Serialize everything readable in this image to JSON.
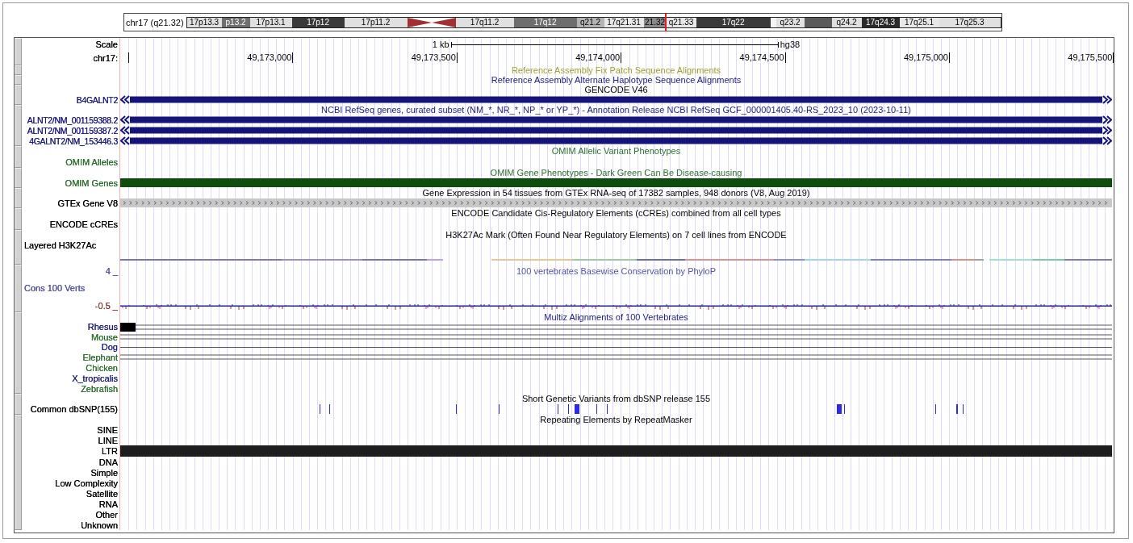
{
  "ideogram": {
    "label": "chr17 (q21.32)",
    "bands": [
      {
        "kind": "band",
        "label": "17p13.3",
        "color": "#e0e0e0",
        "selected": false
      },
      {
        "kind": "band",
        "label": "p13.2",
        "color": "#6e6e6e",
        "selected": false
      },
      {
        "kind": "band",
        "label": "17p13.1",
        "color": "#e0e0e0",
        "selected": false
      },
      {
        "kind": "band",
        "label": "17p12",
        "color": "#3a3a3a",
        "selected": false
      },
      {
        "kind": "band",
        "label": "17p11.2",
        "color": "#e0e0e0",
        "selected": false
      },
      {
        "kind": "centromere",
        "color": "#a33030",
        "selected": false
      },
      {
        "kind": "band",
        "label": "17q11.2",
        "color": "#e0e0e0",
        "selected": false
      },
      {
        "kind": "band",
        "label": "17q12",
        "color": "#6e6e6e",
        "selected": false
      },
      {
        "kind": "band",
        "label": "q21.2",
        "color": "#b4b4b4",
        "selected": false
      },
      {
        "kind": "band",
        "label": "17q21.31",
        "color": "#e8e8e8",
        "selected": false
      },
      {
        "kind": "band",
        "label": "21.32",
        "color": "#8a8a8a",
        "selected": true
      },
      {
        "kind": "band",
        "label": "q21.33",
        "color": "#e8e8e8",
        "selected": false
      },
      {
        "kind": "band",
        "label": "17q22",
        "color": "#3a3a3a",
        "selected": false
      },
      {
        "kind": "band",
        "color": "#f4f4f4",
        "selected": false
      },
      {
        "kind": "band",
        "label": "q23.2",
        "color": "#e0e0e0",
        "selected": false
      },
      {
        "kind": "band",
        "color": "#5a5a5a",
        "selected": false
      },
      {
        "kind": "band",
        "label": "q24.2",
        "color": "#e0e0e0",
        "selected": false
      },
      {
        "kind": "band",
        "label": "17q24.3",
        "color": "#2a2a2a",
        "selected": false
      },
      {
        "kind": "band",
        "label": "17q25.1",
        "color": "#e8e8e8",
        "selected": false
      },
      {
        "kind": "band",
        "label": "17q25.3",
        "color": "#e0e0e0",
        "selected": false
      }
    ]
  },
  "tracks": [
    {
      "rows": [
        {
          "kind": "scale",
          "label": {
            "text": "Scale",
            "color": "#000000"
          },
          "scale_label": "1 kb",
          "assembly": "hg38"
        },
        {
          "kind": "ruler",
          "label": {
            "text": "chr17:",
            "color": "#000000"
          },
          "tick_labels": [
            "49,173,000",
            "49,173,500",
            "49,174,000",
            "49,174,500",
            "49,175,000",
            "49,175,500"
          ]
        }
      ]
    },
    {
      "rows": [
        {
          "kind": "title",
          "title": {
            "text": "Reference Assembly Fix Patch Sequence Alignments",
            "color": "#a0a030"
          }
        }
      ]
    },
    {
      "rows": [
        {
          "kind": "title",
          "title": {
            "text": "Reference Assembly Alternate Haplotype Sequence Alignments",
            "color": "#1c1c80"
          }
        }
      ]
    },
    {
      "rows": [
        {
          "kind": "title",
          "title": {
            "text": "GENCODE V46",
            "color": "#000000"
          }
        },
        {
          "kind": "gene",
          "label": {
            "text": "B4GALNT2",
            "color": "#1c1c80"
          },
          "color": "#14147a"
        }
      ]
    },
    {
      "rows": [
        {
          "kind": "title",
          "title": {
            "text": "NCBI RefSeq genes, curated subset (NM_*, NR_*, NP_* or YP_*) - Annotation Release NCBI RefSeq GCF_000001405.40-RS_2023_10 (2023-10-11)",
            "color": "#1c1c80"
          }
        },
        {
          "kind": "gene",
          "label": {
            "text": "ALNT2/NM_001159388.2",
            "color": "#1c1c80"
          },
          "color": "#14147a"
        },
        {
          "kind": "gene",
          "label": {
            "text": "ALNT2/NM_001159387.2",
            "color": "#1c1c80"
          },
          "color": "#14147a"
        },
        {
          "kind": "gene",
          "label": {
            "text": "4GALNT2/NM_153446.3",
            "color": "#1c1c80"
          },
          "color": "#14147a"
        }
      ]
    },
    {
      "rows": [
        {
          "kind": "title",
          "title": {
            "text": "OMIM Allelic Variant Phenotypes",
            "color": "#2e6e2e"
          }
        },
        {
          "kind": "text",
          "label": {
            "text": "OMIM Alleles",
            "color": "#2e6e2e"
          }
        }
      ]
    },
    {
      "rows": [
        {
          "kind": "title",
          "title": {
            "text": "OMIM Gene Phenotypes - Dark Green Can Be Disease-causing",
            "color": "#2e6e2e"
          }
        },
        {
          "kind": "bar",
          "label": {
            "text": "OMIM Genes",
            "color": "#2e6e2e"
          },
          "color": "#0d4d0d"
        }
      ]
    },
    {
      "rows": [
        {
          "kind": "title",
          "title": {
            "text": "Gene Expression in 54 tissues from GTEx RNA-seq of 17382 samples, 948 donors (V8, Aug 2019)",
            "color": "#000000"
          }
        },
        {
          "kind": "chevrons",
          "label": {
            "text": "GTEx Gene V8",
            "color": "#000000"
          },
          "color": "#c8c8c8"
        }
      ]
    },
    {
      "rows": [
        {
          "kind": "title",
          "title": {
            "text": "ENCODE Candidate Cis-Regulatory Elements (cCREs) combined from all cell types",
            "color": "#000000"
          }
        },
        {
          "kind": "text",
          "label": {
            "text": "ENCODE cCREs",
            "color": "#000000"
          }
        }
      ]
    },
    {
      "rows": [
        {
          "kind": "title",
          "title": {
            "text": "H3K27Ac Mark (Often Found Near Regulatory Elements) on 7 cell lines from ENCODE",
            "color": "#000000"
          }
        },
        {
          "kind": "text-left",
          "label": {
            "text": "Layered H3K27Ac",
            "color": "#000000"
          }
        },
        {
          "kind": "signal"
        }
      ]
    },
    {
      "rows": [
        {
          "kind": "text",
          "label": {
            "text": "4 _",
            "color": "#5555a0"
          },
          "title": {
            "text": "100 vertebrates Basewise Conservation by PhyloP",
            "color": "#5555a0"
          }
        },
        {
          "kind": "tall-text-left",
          "label": {
            "text": "Cons 100 Verts",
            "color": "#5555a0"
          }
        },
        {
          "kind": "wiggle",
          "label": {
            "text": "-0.5 _",
            "color": "#8b3a3a"
          }
        }
      ]
    },
    {
      "rows": [
        {
          "kind": "title",
          "title": {
            "text": "Multiz Alignments of 100 Vertebrates",
            "color": "#1c1c80"
          }
        },
        {
          "kind": "align-block",
          "label": {
            "text": "Rhesus",
            "color": "#1c1c80"
          }
        },
        {
          "kind": "align-double",
          "label": {
            "text": "Mouse",
            "color": "#2e6e2e"
          }
        },
        {
          "kind": "align-single",
          "label": {
            "text": "Dog",
            "color": "#1c1c80"
          }
        },
        {
          "kind": "align-double",
          "label": {
            "text": "Elephant",
            "color": "#2e6e2e"
          }
        },
        {
          "kind": "species",
          "label": {
            "text": "Chicken",
            "color": "#2e6e2e"
          }
        },
        {
          "kind": "species",
          "label": {
            "text": "X_tropicalis",
            "color": "#1c1c80"
          }
        },
        {
          "kind": "species",
          "label": {
            "text": "Zebrafish",
            "color": "#2e6e2e"
          }
        }
      ]
    },
    {
      "rows": [
        {
          "kind": "title",
          "title": {
            "text": "Short Genetic Variants from dbSNP release 155",
            "color": "#000000"
          }
        },
        {
          "kind": "snps",
          "label": {
            "text": "Common dbSNP(155)",
            "color": "#000000"
          },
          "color": "#2a2ae8"
        }
      ]
    },
    {
      "rows": [
        {
          "kind": "title",
          "title": {
            "text": "Repeating Elements by RepeatMasker",
            "color": "#000000"
          }
        },
        {
          "kind": "repeat",
          "label": {
            "text": "SINE",
            "color": "#000000"
          }
        },
        {
          "kind": "repeat",
          "label": {
            "text": "LINE",
            "color": "#000000"
          }
        },
        {
          "kind": "repeat-bar",
          "label": {
            "text": "LTR",
            "color": "#000000"
          },
          "color": "#1e1e1e"
        },
        {
          "kind": "repeat",
          "label": {
            "text": "DNA",
            "color": "#000000"
          }
        },
        {
          "kind": "repeat",
          "label": {
            "text": "Simple",
            "color": "#000000"
          }
        },
        {
          "kind": "repeat",
          "label": {
            "text": "Low Complexity",
            "color": "#000000"
          }
        },
        {
          "kind": "repeat",
          "label": {
            "text": "Satellite",
            "color": "#000000"
          }
        },
        {
          "kind": "repeat",
          "label": {
            "text": "RNA",
            "color": "#000000"
          }
        },
        {
          "kind": "repeat",
          "label": {
            "text": "Other",
            "color": "#000000"
          }
        },
        {
          "kind": "repeat",
          "label": {
            "text": "Unknown",
            "color": "#000000"
          }
        }
      ]
    }
  ]
}
